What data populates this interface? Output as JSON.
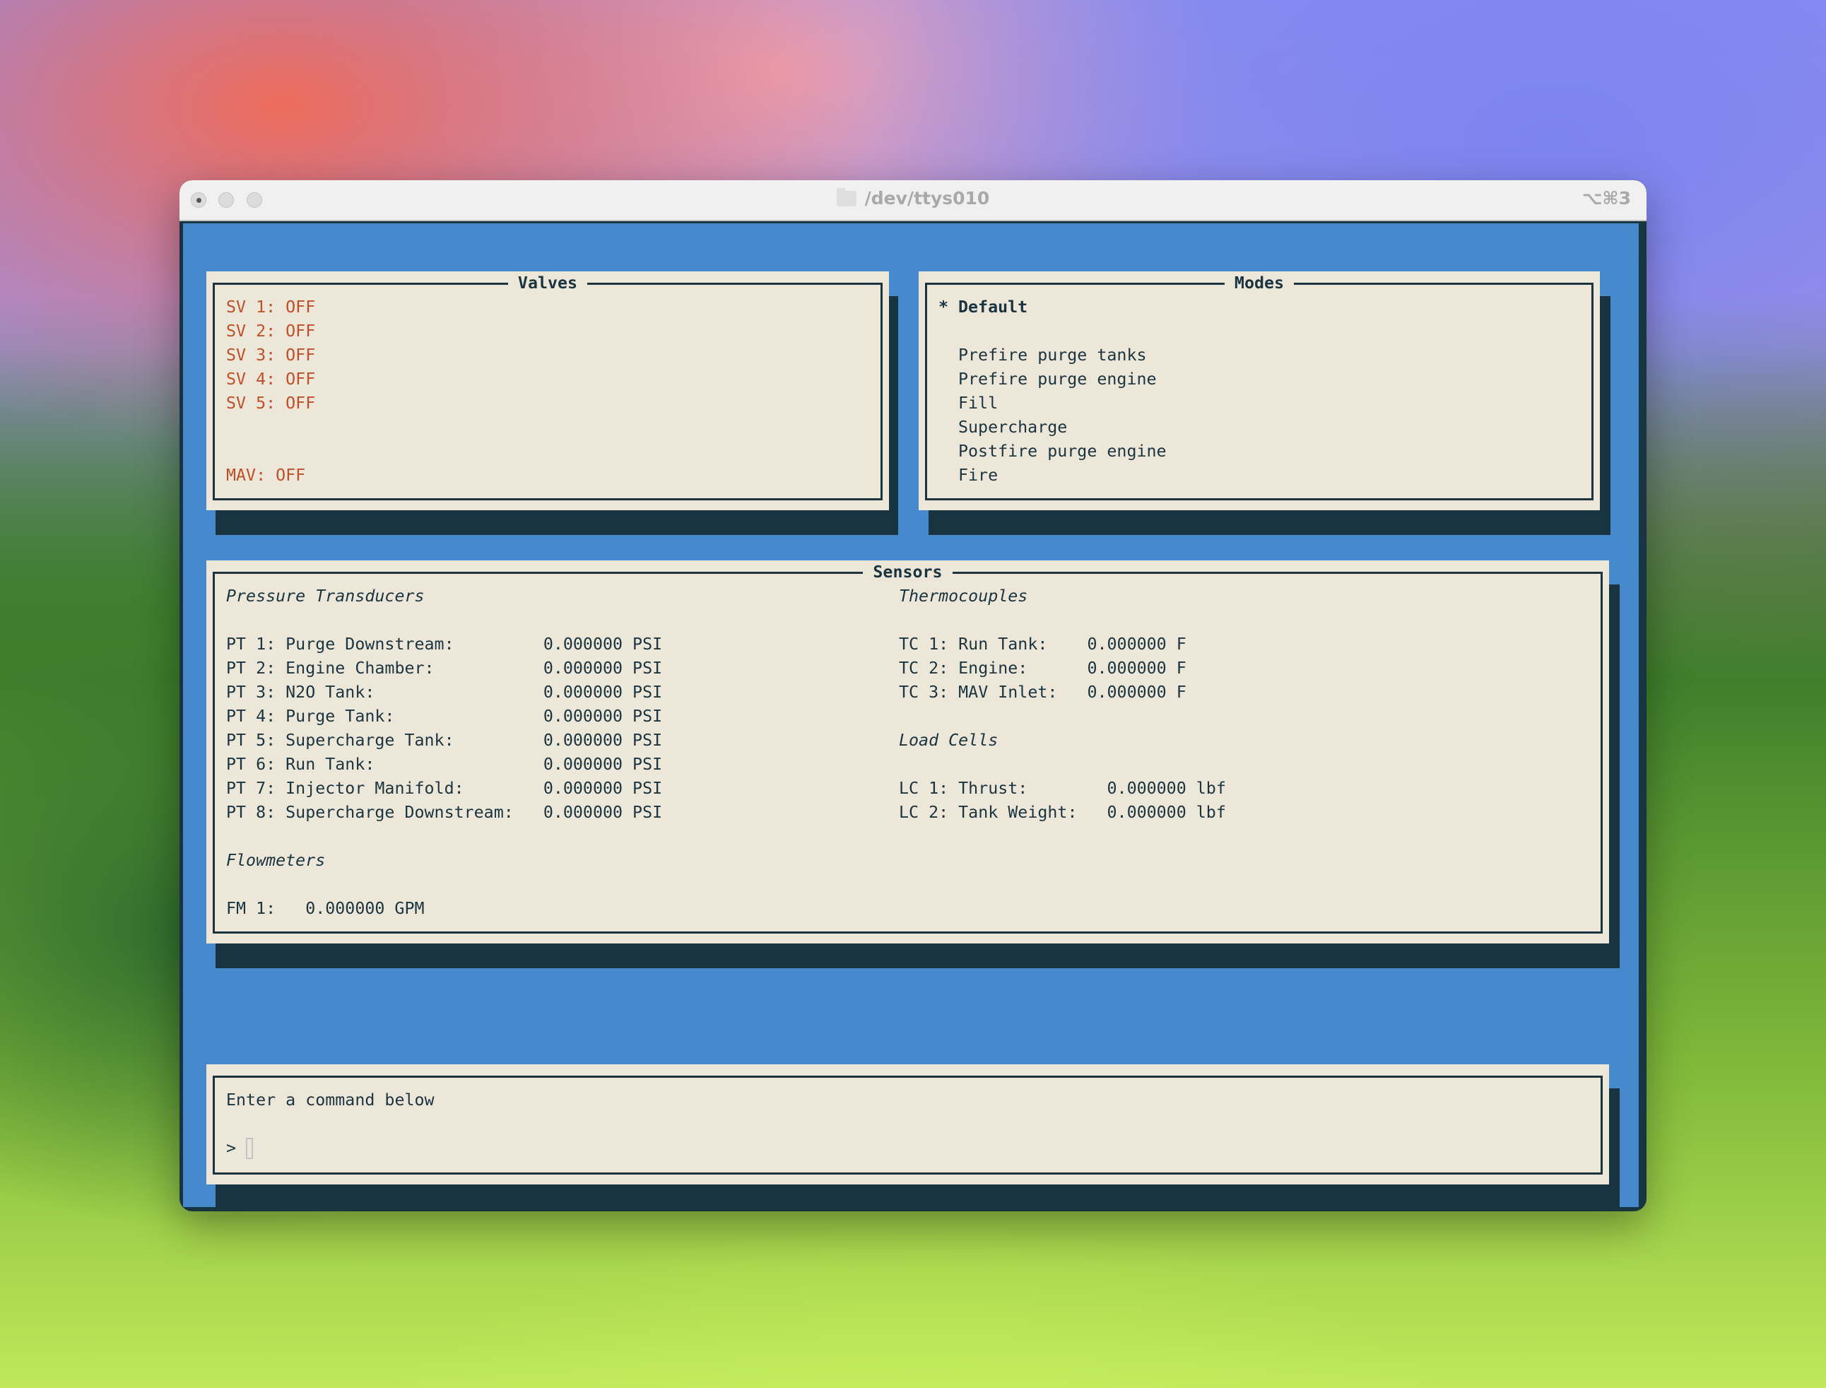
{
  "window": {
    "title": "/dev/ttys010",
    "shortcut": "⌥⌘3",
    "icon": "folder-icon"
  },
  "colors": {
    "background": "#4689cc",
    "panel": "#ece7d8",
    "text": "#1b3440",
    "valve_off": "#c0502a",
    "shadow": "#183440"
  },
  "valves": {
    "title": "Valves",
    "items": [
      "SV 1: OFF",
      "SV 2: OFF",
      "SV 3: OFF",
      "SV 4: OFF",
      "SV 5: OFF"
    ],
    "mav": "MAV: OFF"
  },
  "modes": {
    "title": "Modes",
    "selected_marker": "*",
    "selected": "Default",
    "items": [
      "Prefire purge tanks",
      "Prefire purge engine",
      "Fill",
      "Supercharge",
      "Postfire purge engine",
      "Fire"
    ]
  },
  "sensors": {
    "title": "Sensors",
    "pressure": {
      "heading": "Pressure Transducers",
      "items": [
        {
          "label": "PT 1: Purge Downstream:",
          "value": "0.000000 PSI"
        },
        {
          "label": "PT 2: Engine Chamber:",
          "value": "0.000000 PSI"
        },
        {
          "label": "PT 3: N2O Tank:",
          "value": "0.000000 PSI"
        },
        {
          "label": "PT 4: Purge Tank:",
          "value": "0.000000 PSI"
        },
        {
          "label": "PT 5: Supercharge Tank:",
          "value": "0.000000 PSI"
        },
        {
          "label": "PT 6: Run Tank:",
          "value": "0.000000 PSI"
        },
        {
          "label": "PT 7: Injector Manifold:",
          "value": "0.000000 PSI"
        },
        {
          "label": "PT 8: Supercharge Downstream:",
          "value": "0.000000 PSI"
        }
      ]
    },
    "flowmeters": {
      "heading": "Flowmeters",
      "items": [
        {
          "label": "FM 1:",
          "value": "0.000000 GPM"
        }
      ]
    },
    "thermocouples": {
      "heading": "Thermocouples",
      "items": [
        {
          "label": "TC 1: Run Tank:",
          "value": "0.000000 F"
        },
        {
          "label": "TC 2: Engine:",
          "value": "0.000000 F"
        },
        {
          "label": "TC 3: MAV Inlet:",
          "value": "0.000000 F"
        }
      ]
    },
    "load_cells": {
      "heading": "Load Cells",
      "items": [
        {
          "label": "LC 1: Thrust:",
          "value": "0.000000 lbf"
        },
        {
          "label": "LC 2: Tank Weight:",
          "value": "0.000000 lbf"
        }
      ]
    }
  },
  "command": {
    "prompt_text": "Enter a command below",
    "prompt_symbol": ">",
    "input_value": ""
  }
}
